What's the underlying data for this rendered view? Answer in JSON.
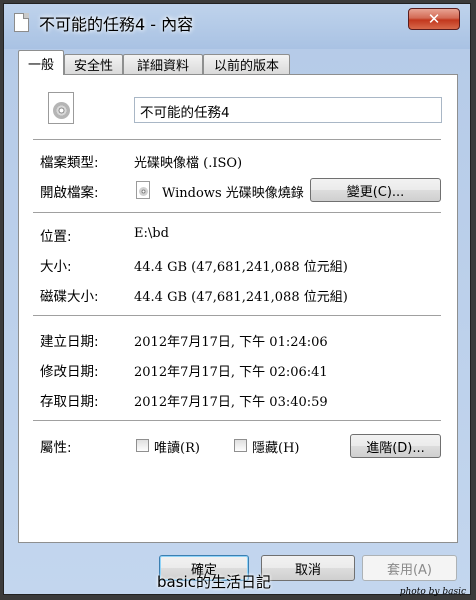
{
  "window": {
    "title": "不可能的任務4 - 內容",
    "close_glyph": "✕"
  },
  "tabs": [
    {
      "label": "一般"
    },
    {
      "label": "安全性"
    },
    {
      "label": "詳細資料"
    },
    {
      "label": "以前的版本"
    }
  ],
  "general": {
    "filename": "不可能的任務4",
    "type_label": "檔案類型:",
    "type_value": "光碟映像檔 (.ISO)",
    "opens_label": "開啟檔案:",
    "opens_value": "Windows 光碟映像燒錄",
    "change_button": "變更(C)...",
    "location_label": "位置:",
    "location_value": "E:\\bd",
    "size_label": "大小:",
    "size_value": "44.4 GB (47,681,241,088 位元組)",
    "disk_size_label": "磁碟大小:",
    "disk_size_value": "44.4 GB (47,681,241,088 位元組)",
    "created_label": "建立日期:",
    "created_value": "2012年7月17日, 下午 01:24:06",
    "modified_label": "修改日期:",
    "modified_value": "2012年7月17日, 下午 02:06:41",
    "accessed_label": "存取日期:",
    "accessed_value": "2012年7月17日, 下午 03:40:59",
    "attributes_label": "屬性:",
    "readonly_label": "唯讀(R)",
    "hidden_label": "隱藏(H)",
    "advanced_button": "進階(D)..."
  },
  "footer": {
    "ok": "確定",
    "cancel": "取消",
    "apply": "套用(A)"
  },
  "overlay": {
    "watermark": "basic的生活日記",
    "signature": "photo by basic"
  },
  "colors": {
    "accent": "#3c7fb1",
    "close_button": "#c2371d"
  },
  "icons": {
    "file": "disc-image-icon",
    "program": "disc-burner-icon"
  }
}
